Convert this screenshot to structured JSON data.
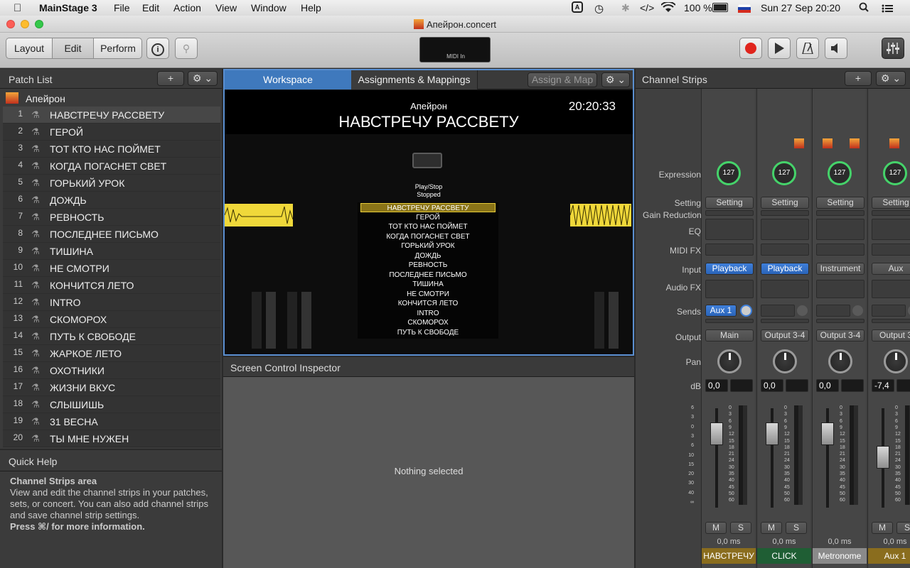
{
  "menubar": {
    "app_name": "MainStage 3",
    "items": [
      "File",
      "Edit",
      "Action",
      "View",
      "Window",
      "Help"
    ],
    "battery": "100 %",
    "datetime": "Sun 27 Sep  20:20"
  },
  "window": {
    "title": "Апейрон.concert"
  },
  "toolbar": {
    "modes": [
      "Layout",
      "Edit",
      "Perform"
    ],
    "midi_in_label": "MIDI In"
  },
  "patch_list": {
    "header": "Patch List",
    "concert_name": "Апейрон",
    "patches": [
      {
        "num": "1",
        "name": "НАВСТРЕЧУ РАССВЕТУ"
      },
      {
        "num": "2",
        "name": "ГЕРОЙ"
      },
      {
        "num": "3",
        "name": "ТОТ КТО НАС ПОЙМЕТ"
      },
      {
        "num": "4",
        "name": "КОГДА ПОГАСНЕТ СВЕТ"
      },
      {
        "num": "5",
        "name": "ГОРЬКИЙ УРОК"
      },
      {
        "num": "6",
        "name": "ДОЖДЬ"
      },
      {
        "num": "7",
        "name": "РЕВНОСТЬ"
      },
      {
        "num": "8",
        "name": "ПОСЛЕДНЕЕ ПИСЬМО"
      },
      {
        "num": "9",
        "name": "ТИШИНА"
      },
      {
        "num": "10",
        "name": "НЕ СМОТРИ"
      },
      {
        "num": "11",
        "name": "КОНЧИТСЯ ЛЕТО"
      },
      {
        "num": "12",
        "name": "INTRO"
      },
      {
        "num": "13",
        "name": "СКОМОРОХ"
      },
      {
        "num": "14",
        "name": "ПУТЬ К СВОБОДЕ"
      },
      {
        "num": "15",
        "name": "ЖАРКОЕ ЛЕТО"
      },
      {
        "num": "16",
        "name": "ОХОТНИКИ"
      },
      {
        "num": "17",
        "name": "ЖИЗНИ ВКУС"
      },
      {
        "num": "18",
        "name": "СЛЫШИШЬ"
      },
      {
        "num": "19",
        "name": "31 ВЕСНА"
      },
      {
        "num": "20",
        "name": "ТЫ МНЕ НУЖЕН"
      }
    ]
  },
  "quick_help": {
    "header": "Quick Help",
    "title": "Channel Strips area",
    "body": "View and edit the channel strips in your patches, sets, or concert. You can also add channel strips and save channel strip settings.",
    "more": "Press ⌘/ for more information."
  },
  "workspace": {
    "tabs": [
      "Workspace",
      "Assignments & Mappings"
    ],
    "assign_map": "Assign & Map",
    "concert_name": "Апейрон",
    "current_patch": "НАВСТРЕЧУ РАССВЕТУ",
    "clock": "20:20:33",
    "play_stop_label": "Play/Stop",
    "play_stop_state": "Stopped",
    "patch_list": [
      "НАВСТРЕЧУ РАССВЕТУ",
      "ГЕРОЙ",
      "ТОТ КТО НАС ПОЙМЕТ",
      "КОГДА ПОГАСНЕТ СВЕТ",
      "ГОРЬКИЙ УРОК",
      "ДОЖДЬ",
      "РЕВНОСТЬ",
      "ПОСЛЕДНЕЕ ПИСЬМО",
      "ТИШИНА",
      "НЕ СМОТРИ",
      "КОНЧИТСЯ ЛЕТО",
      "INTRO",
      "СКОМОРОХ",
      "ПУТЬ К СВОБОДЕ"
    ]
  },
  "inspector": {
    "header": "Screen Control Inspector",
    "empty": "Nothing selected"
  },
  "channel_strips": {
    "header": "Channel Strips",
    "row_labels": {
      "expression": "Expression",
      "setting": "Setting",
      "gain_reduction": "Gain Reduction",
      "eq": "EQ",
      "midi_fx": "MIDI FX",
      "input": "Input",
      "audio_fx": "Audio FX",
      "sends": "Sends",
      "output": "Output",
      "pan": "Pan",
      "db": "dB"
    },
    "strips": [
      {
        "name": "НАВСТРЕЧУ",
        "expression": "127",
        "setting": "Setting",
        "input": "Playback",
        "send": "Aux 1",
        "output": "Main",
        "db": "0,0",
        "delay": "0,0 ms",
        "mute": "M",
        "solo": "S",
        "name_color": "#8a6d1e"
      },
      {
        "name": "CLICK",
        "expression": "127",
        "setting": "Setting",
        "input": "Playback",
        "send": "",
        "output": "Output 3-4",
        "db": "0,0",
        "delay": "0,0 ms",
        "mute": "M",
        "solo": "S",
        "name_color": "#1f5e34"
      },
      {
        "name": "Metronome",
        "expression": "127",
        "setting": "Setting",
        "input": "Instrument",
        "send": "",
        "output": "Output 3-4",
        "db": "0,0",
        "delay": "0,0 ms",
        "mute": "",
        "solo": "",
        "name_color": "#8a8a8a"
      },
      {
        "name": "Aux 1",
        "expression": "127",
        "setting": "Setting",
        "input": "Aux",
        "send": "",
        "output": "Output 3",
        "db": "-7,4",
        "delay": "0,0 ms",
        "mute": "M",
        "solo": "S",
        "name_color": "#8a6d1e"
      }
    ],
    "fader_scale_left": [
      "6",
      "3",
      "0",
      "3",
      "6",
      "10",
      "15",
      "20",
      "30",
      "40",
      "∞"
    ],
    "fader_scale_right": [
      "0",
      "3",
      "6",
      "9",
      "12",
      "15",
      "18",
      "21",
      "24",
      "30",
      "35",
      "40",
      "45",
      "50",
      "60"
    ]
  }
}
